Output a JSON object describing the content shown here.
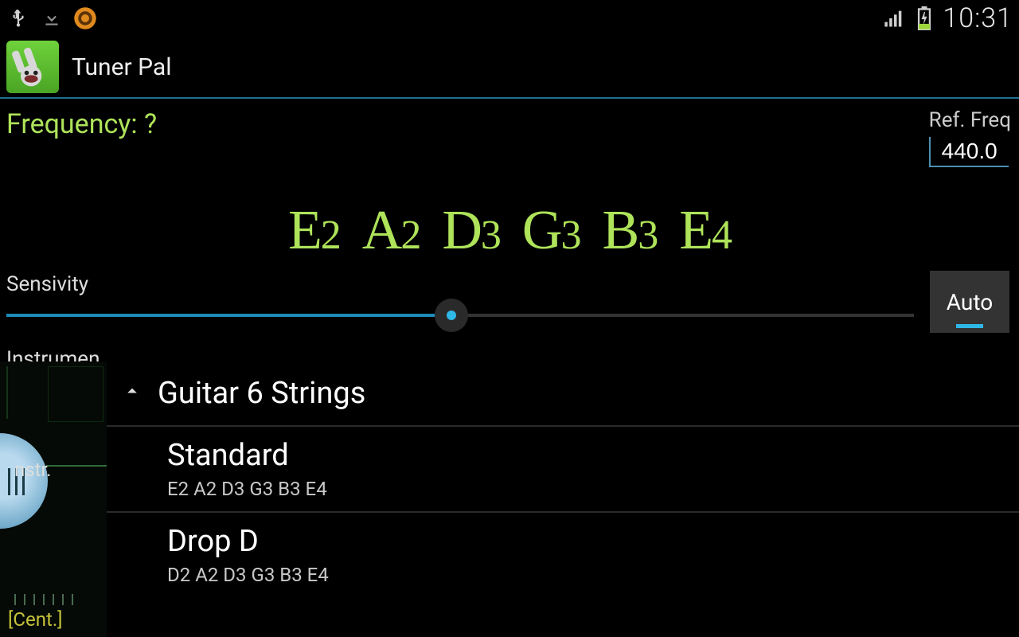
{
  "status": {
    "clock": "10:31"
  },
  "app": {
    "title": "Tuner Pal"
  },
  "frequency": {
    "label": "Frequency: ?"
  },
  "ref": {
    "label": "Ref. Freq",
    "value": "440.0"
  },
  "notes": [
    "E2",
    "A2",
    "D3",
    "G3",
    "B3",
    "E4"
  ],
  "sensitivity": {
    "label": "Sensivity",
    "percent": 49
  },
  "auto_label": "Auto",
  "instrument_label": "Instrumen",
  "left_panel": {
    "nstr": "nstr.",
    "cent": "[Cent.]"
  },
  "dropdown": {
    "header": "Guitar 6 Strings",
    "items": [
      {
        "name": "Standard",
        "sub": "E2 A2 D3 G3 B3 E4"
      },
      {
        "name": "Drop D",
        "sub": "D2 A2 D3 G3 B3 E4"
      }
    ]
  }
}
